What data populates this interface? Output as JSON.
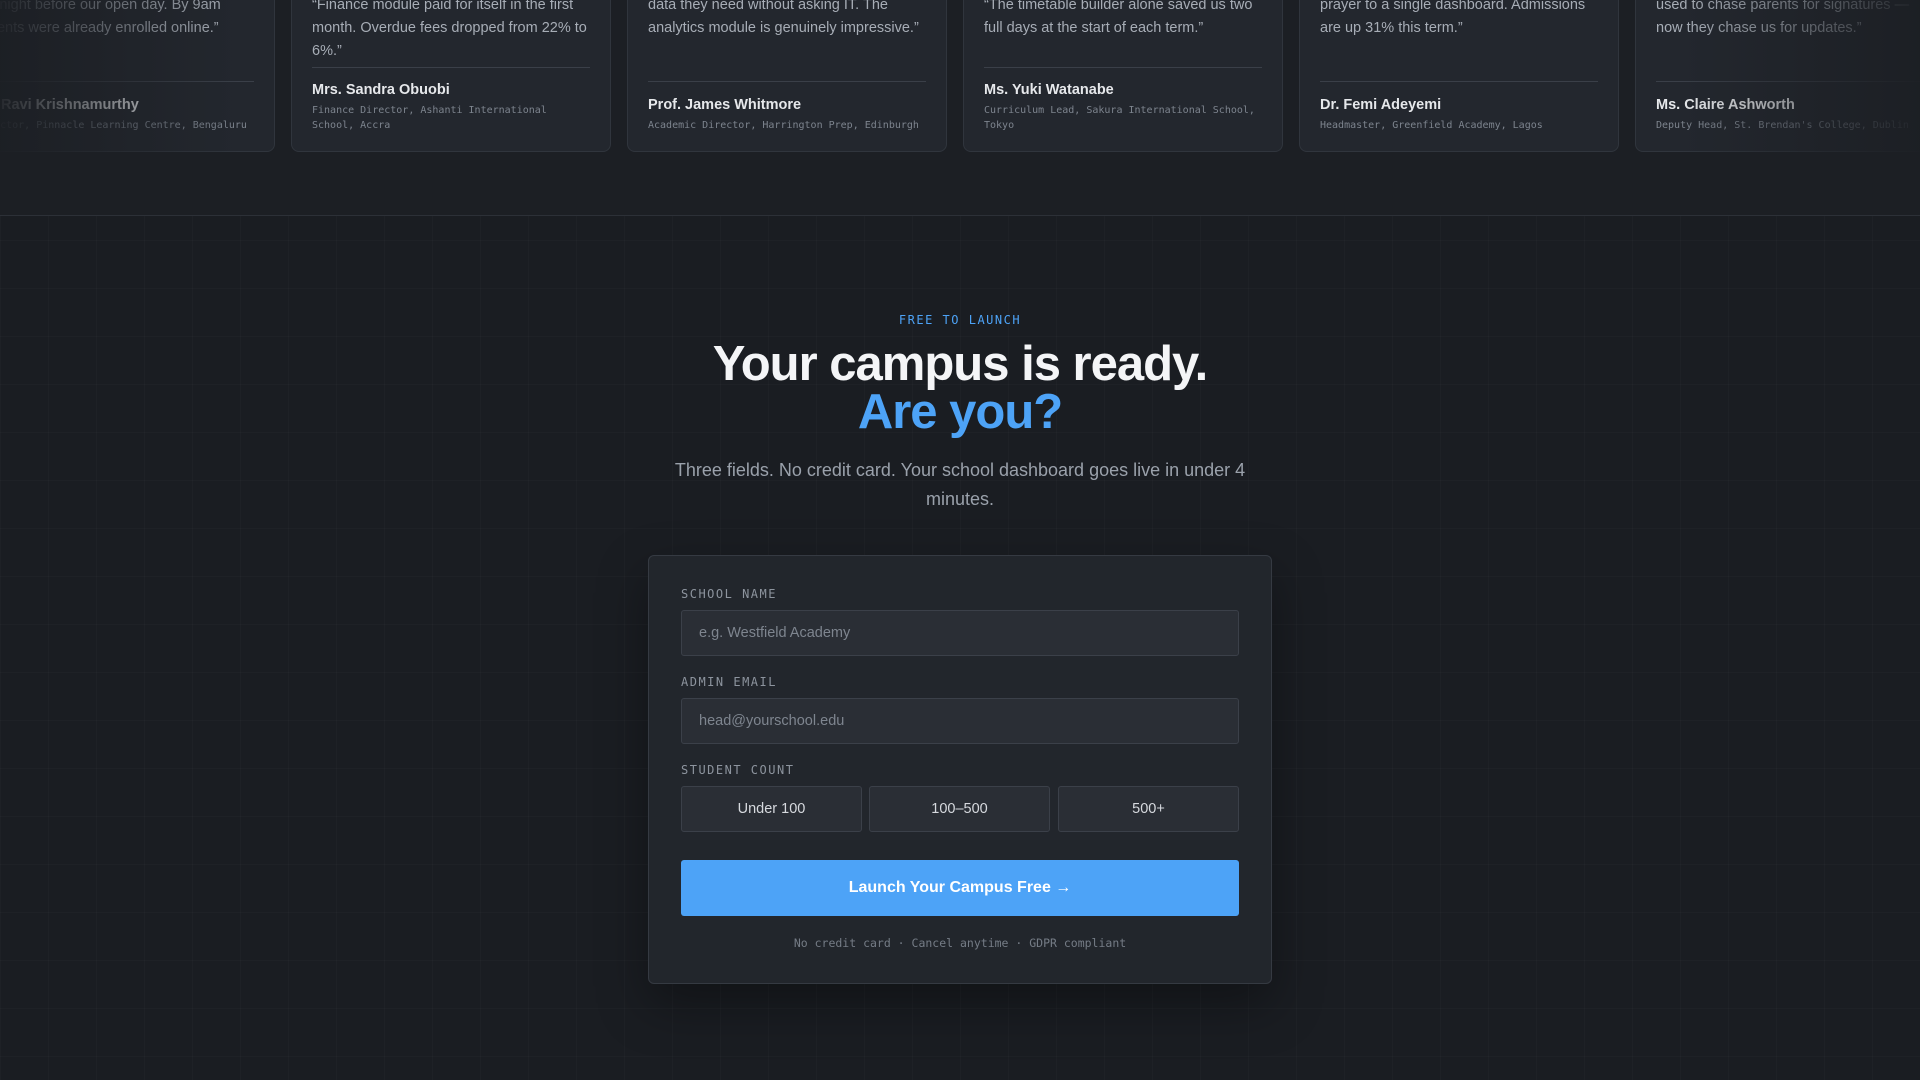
{
  "testimonials": [
    {
      "quote": "“We moved our entire online presence at midnight before our open day. By 9am parents were already enrolled online.”",
      "name": "Mr. Ravi Krishnamurthy",
      "role": "Director, Pinnacle Learning Centre, Bengaluru"
    },
    {
      "quote": "“Finance module paid for itself in the first month. Overdue fees dropped from 22% to 6%.”",
      "name": "Mrs. Sandra Obuobi",
      "role": "Finance Director, Ashanti International School, Accra"
    },
    {
      "quote": "“Our department heads finally have the data they need without asking IT. The analytics module is genuinely impressive.”",
      "name": "Prof. James Whitmore",
      "role": "Academic Director, Harrington Prep, Edinburgh"
    },
    {
      "quote": "“The timetable builder alone saved us two full days at the start of each term.”",
      "name": "Ms. Yuki Watanabe",
      "role": "Curriculum Lead, Sakura International School, Tokyo"
    },
    {
      "quote": "“We went from three spreadsheets and a prayer to a single dashboard. Admissions are up 31% this term.”",
      "name": "Dr. Femi Adeyemi",
      "role": "Headmaster, Greenfield Academy, Lagos"
    },
    {
      "quote": "“The parent portal actually gets used. We used to chase parents for signatures — now they chase us for updates.”",
      "name": "Ms. Claire Ashworth",
      "role": "Deputy Head, St. Brendan's College, Dublin"
    }
  ],
  "cta": {
    "eyebrow": "FREE TO LAUNCH",
    "headline": "Your campus is ready.",
    "headline_accent": "Are you?",
    "subtitle": "Three fields. No credit card. Your school dashboard goes live in under 4 minutes."
  },
  "form": {
    "school_label": "SCHOOL NAME",
    "school_placeholder": "e.g. Westfield Academy",
    "email_label": "ADMIN EMAIL",
    "email_placeholder": "head@yourschool.edu",
    "count_label": "STUDENT COUNT",
    "count_options": [
      "Under 100",
      "100–500",
      "500+"
    ],
    "submit_label": "Launch Your Campus Free →",
    "fine_print": "No credit card · Cancel anytime · GDPR compliant"
  },
  "colors": {
    "background": "#1a1d22",
    "accent": "#4da3f7",
    "card": "#22262c"
  }
}
